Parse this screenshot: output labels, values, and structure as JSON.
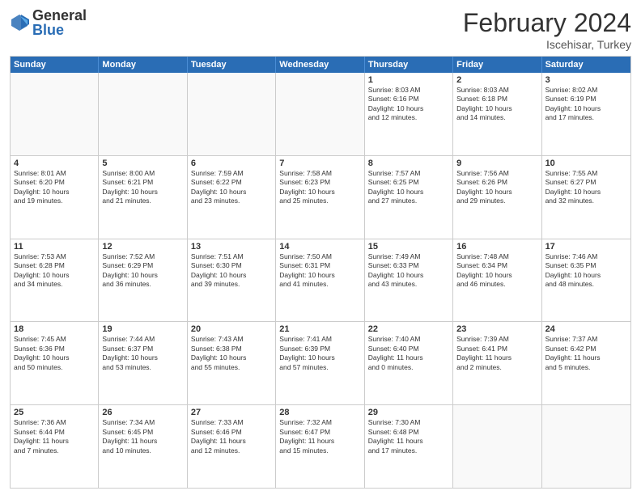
{
  "header": {
    "logo": {
      "general": "General",
      "blue": "Blue"
    },
    "month_title": "February 2024",
    "subtitle": "Iscehisar, Turkey"
  },
  "days_of_week": [
    "Sunday",
    "Monday",
    "Tuesday",
    "Wednesday",
    "Thursday",
    "Friday",
    "Saturday"
  ],
  "weeks": [
    [
      {
        "day": "",
        "info": ""
      },
      {
        "day": "",
        "info": ""
      },
      {
        "day": "",
        "info": ""
      },
      {
        "day": "",
        "info": ""
      },
      {
        "day": "1",
        "info": "Sunrise: 8:03 AM\nSunset: 6:16 PM\nDaylight: 10 hours\nand 12 minutes."
      },
      {
        "day": "2",
        "info": "Sunrise: 8:03 AM\nSunset: 6:18 PM\nDaylight: 10 hours\nand 14 minutes."
      },
      {
        "day": "3",
        "info": "Sunrise: 8:02 AM\nSunset: 6:19 PM\nDaylight: 10 hours\nand 17 minutes."
      }
    ],
    [
      {
        "day": "4",
        "info": "Sunrise: 8:01 AM\nSunset: 6:20 PM\nDaylight: 10 hours\nand 19 minutes."
      },
      {
        "day": "5",
        "info": "Sunrise: 8:00 AM\nSunset: 6:21 PM\nDaylight: 10 hours\nand 21 minutes."
      },
      {
        "day": "6",
        "info": "Sunrise: 7:59 AM\nSunset: 6:22 PM\nDaylight: 10 hours\nand 23 minutes."
      },
      {
        "day": "7",
        "info": "Sunrise: 7:58 AM\nSunset: 6:23 PM\nDaylight: 10 hours\nand 25 minutes."
      },
      {
        "day": "8",
        "info": "Sunrise: 7:57 AM\nSunset: 6:25 PM\nDaylight: 10 hours\nand 27 minutes."
      },
      {
        "day": "9",
        "info": "Sunrise: 7:56 AM\nSunset: 6:26 PM\nDaylight: 10 hours\nand 29 minutes."
      },
      {
        "day": "10",
        "info": "Sunrise: 7:55 AM\nSunset: 6:27 PM\nDaylight: 10 hours\nand 32 minutes."
      }
    ],
    [
      {
        "day": "11",
        "info": "Sunrise: 7:53 AM\nSunset: 6:28 PM\nDaylight: 10 hours\nand 34 minutes."
      },
      {
        "day": "12",
        "info": "Sunrise: 7:52 AM\nSunset: 6:29 PM\nDaylight: 10 hours\nand 36 minutes."
      },
      {
        "day": "13",
        "info": "Sunrise: 7:51 AM\nSunset: 6:30 PM\nDaylight: 10 hours\nand 39 minutes."
      },
      {
        "day": "14",
        "info": "Sunrise: 7:50 AM\nSunset: 6:31 PM\nDaylight: 10 hours\nand 41 minutes."
      },
      {
        "day": "15",
        "info": "Sunrise: 7:49 AM\nSunset: 6:33 PM\nDaylight: 10 hours\nand 43 minutes."
      },
      {
        "day": "16",
        "info": "Sunrise: 7:48 AM\nSunset: 6:34 PM\nDaylight: 10 hours\nand 46 minutes."
      },
      {
        "day": "17",
        "info": "Sunrise: 7:46 AM\nSunset: 6:35 PM\nDaylight: 10 hours\nand 48 minutes."
      }
    ],
    [
      {
        "day": "18",
        "info": "Sunrise: 7:45 AM\nSunset: 6:36 PM\nDaylight: 10 hours\nand 50 minutes."
      },
      {
        "day": "19",
        "info": "Sunrise: 7:44 AM\nSunset: 6:37 PM\nDaylight: 10 hours\nand 53 minutes."
      },
      {
        "day": "20",
        "info": "Sunrise: 7:43 AM\nSunset: 6:38 PM\nDaylight: 10 hours\nand 55 minutes."
      },
      {
        "day": "21",
        "info": "Sunrise: 7:41 AM\nSunset: 6:39 PM\nDaylight: 10 hours\nand 57 minutes."
      },
      {
        "day": "22",
        "info": "Sunrise: 7:40 AM\nSunset: 6:40 PM\nDaylight: 11 hours\nand 0 minutes."
      },
      {
        "day": "23",
        "info": "Sunrise: 7:39 AM\nSunset: 6:41 PM\nDaylight: 11 hours\nand 2 minutes."
      },
      {
        "day": "24",
        "info": "Sunrise: 7:37 AM\nSunset: 6:42 PM\nDaylight: 11 hours\nand 5 minutes."
      }
    ],
    [
      {
        "day": "25",
        "info": "Sunrise: 7:36 AM\nSunset: 6:44 PM\nDaylight: 11 hours\nand 7 minutes."
      },
      {
        "day": "26",
        "info": "Sunrise: 7:34 AM\nSunset: 6:45 PM\nDaylight: 11 hours\nand 10 minutes."
      },
      {
        "day": "27",
        "info": "Sunrise: 7:33 AM\nSunset: 6:46 PM\nDaylight: 11 hours\nand 12 minutes."
      },
      {
        "day": "28",
        "info": "Sunrise: 7:32 AM\nSunset: 6:47 PM\nDaylight: 11 hours\nand 15 minutes."
      },
      {
        "day": "29",
        "info": "Sunrise: 7:30 AM\nSunset: 6:48 PM\nDaylight: 11 hours\nand 17 minutes."
      },
      {
        "day": "",
        "info": ""
      },
      {
        "day": "",
        "info": ""
      }
    ]
  ]
}
